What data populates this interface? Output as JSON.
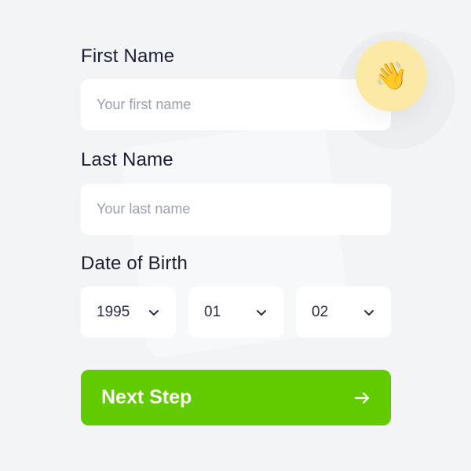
{
  "form": {
    "first_name_label": "First Name",
    "first_name_placeholder": "Your first name",
    "last_name_label": "Last Name",
    "last_name_placeholder": "Your last name",
    "dob_label": "Date of Birth",
    "year_value": "1995",
    "month_value": "01",
    "day_value": "02",
    "next_button_label": "Next Step"
  },
  "decor": {
    "wave_emoji": "👋"
  },
  "colors": {
    "background": "#f3f4f6",
    "label": "#1a1d3a",
    "accent": "#62cb00",
    "wave_badge": "#fde9a6"
  },
  "icons": {
    "chevron": "chevron-down-icon",
    "arrow": "arrow-right-icon",
    "wave": "waving-hand-icon"
  }
}
